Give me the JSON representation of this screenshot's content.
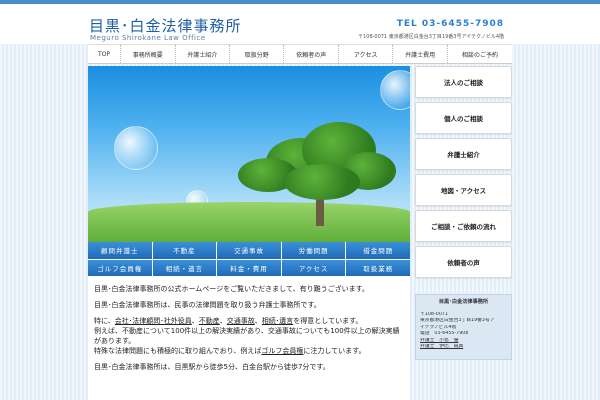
{
  "header": {
    "logo_ja": "目黒･白金法律事務所",
    "logo_en": "Meguro Shirokane Law Office",
    "tel": "TEL 03-6455-7908",
    "address": "〒108-0071 東京都港区白金台3丁目19番3号アイテクノビル4階"
  },
  "nav": [
    "TOP",
    "事務所概要",
    "弁護士紹介",
    "取扱分野",
    "依頼者の声",
    "アクセス",
    "弁護士費用",
    "相談のご予約"
  ],
  "grid_buttons": [
    "顧問弁護士",
    "不動産",
    "交通事故",
    "労働問題",
    "借金問題",
    "ゴルフ会員権",
    "相続・遺言",
    "料金・費用",
    "アクセス",
    "取扱業務"
  ],
  "side_buttons": [
    "法人のご相談",
    "個人のご相談",
    "弁護士紹介",
    "地図・アクセス",
    "ご相談・ご依頼の流れ",
    "依頼者の声"
  ],
  "content": {
    "p1": "目黒･白金法律事務所の公式ホームページをご覧いただきまして、有り難うございます。",
    "p2": "目黒･白金法律事務所は、民事の法律問題を取り扱う弁護士事務所です。",
    "p3_prefix": "特に、",
    "p3_link1": "会社･法律顧問･社外役員",
    "p3_sep1": "、",
    "p3_link2": "不動産",
    "p3_sep2": "、",
    "p3_link3": "交通事故",
    "p3_sep3": "、",
    "p3_link4": "相続･遺言",
    "p3_suffix": "を得意としています。",
    "p4": "例えば、不動産について100件以上の解決実績があり、交通事故についても100件以上の解決実績があります。",
    "p5_prefix": "特殊な法律問題にも積極的に取り組んでおり、例えば",
    "p5_link": "ゴルフ会員権",
    "p5_suffix": "に注力しています。",
    "p6": "目黒･白金法律事務所は、目黒駅から徒歩5分、白金台駅から徒歩7分です。"
  },
  "infobox": {
    "title": "目黒･白金法律事務所",
    "zip": "〒108-0071",
    "addr1": "東京都港区白金台3丁目19番3号ア",
    "addr2": "イテクノビル4階",
    "phone": "電話　03-6455-7908",
    "lawyer1": "弁護士　小島　優",
    "lawyer2": "弁護士　伊比　陽典"
  },
  "colors": {
    "brand": "#1f5fa3",
    "accent": "#2a7fd0",
    "button": "#1f6bb8"
  }
}
